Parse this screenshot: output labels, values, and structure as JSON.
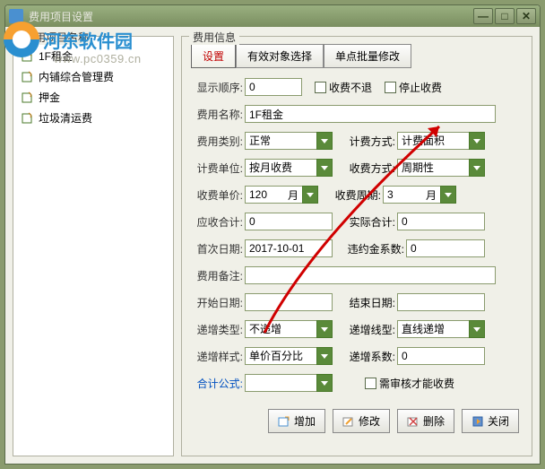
{
  "titlebar": {
    "text": "费用项目设置"
  },
  "watermark": {
    "text": "河东软件园",
    "url": "www.pc0359.cn"
  },
  "leftPanel": {
    "title": "费用项目名称",
    "items": [
      {
        "label": "1F租金"
      },
      {
        "label": "内铺综合管理费"
      },
      {
        "label": "押金"
      },
      {
        "label": "垃圾清运费"
      }
    ]
  },
  "rightPanel": {
    "title": "费用信息",
    "tabs": {
      "t1": "设置",
      "t2": "有效对象选择",
      "t3": "单点批量修改"
    },
    "labels": {
      "displayOrder": "显示顺序",
      "noRefund": "收费不退",
      "stopCharge": "停止收费",
      "feeName": "费用名称",
      "feeType": "费用类别",
      "calcMethod": "计费方式",
      "calcUnit": "计费单位",
      "chargeMethod": "收费方式",
      "unitPrice": "收费单价",
      "chargeCycle": "收费周期",
      "receivableTotal": "应收合计",
      "actualTotal": "实际合计",
      "firstDate": "首次日期",
      "penaltyFactor": "违约金系数",
      "feeRemark": "费用备注",
      "startDate": "开始日期",
      "endDate": "结束日期",
      "incrementType": "递增类型",
      "incrementLine": "递增线型",
      "incrementStyle": "递增样式",
      "incrementFactor": "递增系数",
      "formulaLabel": "合计公式",
      "needAudit": "需审核才能收费"
    },
    "values": {
      "displayOrder": "0",
      "feeName": "1F租金",
      "feeType": "正常",
      "calcMethod": "计费面积",
      "calcUnit": "按月收费",
      "chargeMethod": "周期性",
      "unitPrice": "120",
      "unitPriceUnit": "月",
      "chargeCycle": "3",
      "chargeCycleUnit": "月",
      "receivableTotal": "0",
      "actualTotal": "0",
      "firstDate": "2017-10-01",
      "penaltyFactor": "0",
      "feeRemark": "",
      "startDate": "",
      "endDate": "",
      "incrementType": "不递增",
      "incrementLine": "直线递增",
      "incrementStyle": "单价百分比",
      "incrementFactor": "0",
      "formula": ""
    },
    "buttons": {
      "add": "增加",
      "edit": "修改",
      "delete": "删除",
      "close": "关闭"
    }
  }
}
